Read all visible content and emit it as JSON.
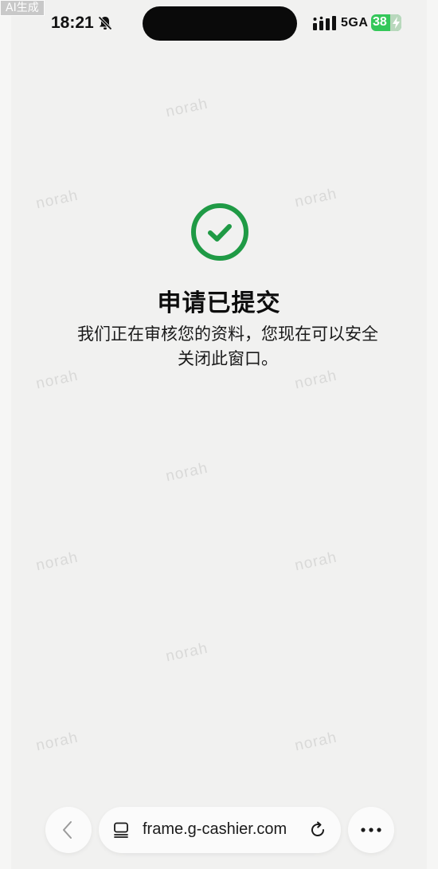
{
  "ai_tag": "AI生成",
  "status_bar": {
    "time": "18:21",
    "network": "5GA",
    "battery": "38"
  },
  "watermark": "norah",
  "content": {
    "title": "申请已提交",
    "message": "我们正在审核您的资料，您现在可以安全关闭此窗口。"
  },
  "browser": {
    "url": "frame.g-cashier.com"
  },
  "colors": {
    "success": "#1f9a45",
    "battery": "#34c759"
  }
}
